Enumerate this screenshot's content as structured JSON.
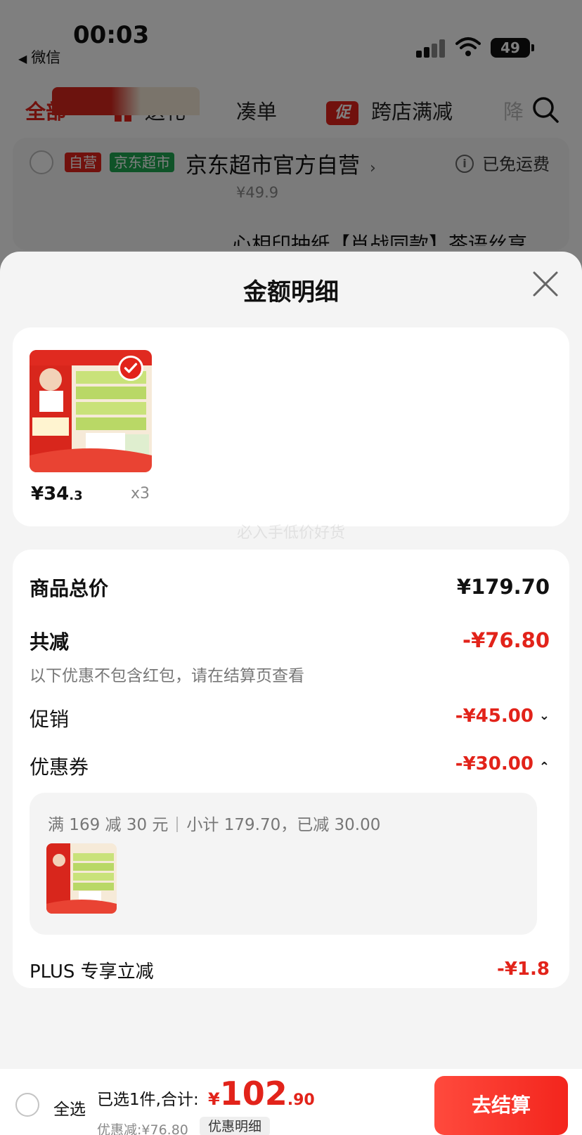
{
  "status_bar": {
    "time": "00:03",
    "back_app": "微信",
    "battery": "49"
  },
  "category_tabs": [
    {
      "label": "全部",
      "active": true
    },
    {
      "label": "送礼",
      "icon": "gift-icon"
    },
    {
      "label": "凑单"
    },
    {
      "label": "跨店满减",
      "badge": "促"
    },
    {
      "label": "降"
    }
  ],
  "shop": {
    "tag_self": "自营",
    "tag_channel": "京东超市",
    "name": "京东超市官方自营",
    "shipping": "已免运费",
    "price": "¥49.9",
    "product_title": "心相印抽纸【肖战同款】茶语丝享"
  },
  "sheet": {
    "title": "金额明细",
    "watermark": "必入手低价好货",
    "product": {
      "price_int": "¥34",
      "price_dec": ".3",
      "qty": "x3"
    },
    "rows": {
      "total_label": "商品总价",
      "total_value": "¥179.70",
      "reduce_label": "共减",
      "reduce_value": "-¥76.80",
      "note": "以下优惠不包含红包，请在结算页查看",
      "promo_label": "促销",
      "promo_value": "-¥45.00",
      "coupon_label": "优惠券",
      "coupon_value": "-¥30.00",
      "plus_label": "PLUS 专享立减",
      "plus_value": "-¥1.8"
    },
    "coupon_detail": {
      "rule": "满 169 减 30 元",
      "subtotal": "小计 179.70，已减 30.00"
    }
  },
  "bottom_bar": {
    "select_all": "全选",
    "selected": "已选1件,合计:",
    "currency": "¥",
    "total_int": "102",
    "total_dec": ".90",
    "discount": "优惠减:¥76.80",
    "detail_link": "优惠明细",
    "checkout": "去结算"
  },
  "colors": {
    "accent_red": "#e2231a",
    "jd_green": "#1fa651"
  }
}
